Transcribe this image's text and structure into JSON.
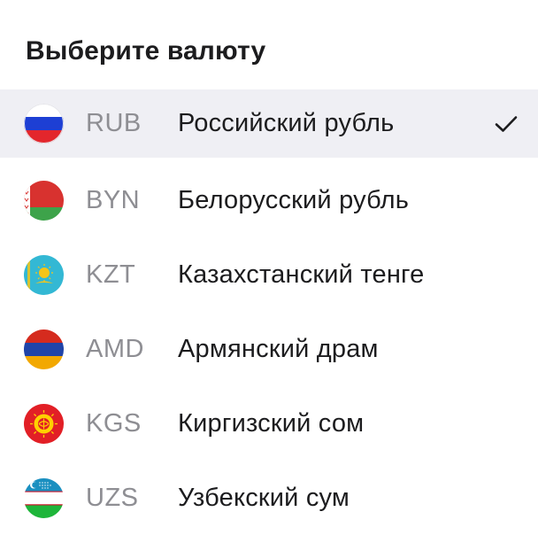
{
  "header": {
    "title": "Выберите валюту"
  },
  "currencies": [
    {
      "code": "RUB",
      "name": "Российский рубль",
      "flag_icon": "russia-flag-icon",
      "selected": true
    },
    {
      "code": "BYN",
      "name": "Белорусский рубль",
      "flag_icon": "belarus-flag-icon",
      "selected": false
    },
    {
      "code": "KZT",
      "name": "Казахстанский тенге",
      "flag_icon": "kazakhstan-flag-icon",
      "selected": false
    },
    {
      "code": "AMD",
      "name": "Армянский драм",
      "flag_icon": "armenia-flag-icon",
      "selected": false
    },
    {
      "code": "KGS",
      "name": "Киргизский сом",
      "flag_icon": "kyrgyzstan-flag-icon",
      "selected": false
    },
    {
      "code": "UZS",
      "name": "Узбекский сум",
      "flag_icon": "uzbekistan-flag-icon",
      "selected": false
    }
  ],
  "colors": {
    "selected_row_bg": "#efeff4",
    "code_text": "#8e8e93",
    "name_text": "#1c1c1e",
    "check": "#1c1c1e"
  }
}
